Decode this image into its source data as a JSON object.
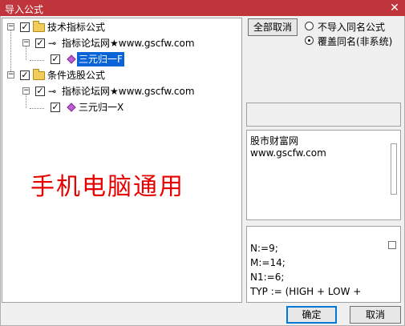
{
  "window": {
    "title": "导入公式",
    "close_glyph": "✕"
  },
  "tree": {
    "nodes": [
      {
        "label": "技术指标公式",
        "expander": "−",
        "checked": "✓"
      },
      {
        "label": "指标论坛网★www.gscfw.com",
        "expander": "−",
        "checked": "✓"
      },
      {
        "label": "三元归一F",
        "checked": "✓",
        "selected": true
      },
      {
        "label": "条件选股公式",
        "expander": "−",
        "checked": "✓"
      },
      {
        "label": "指标论坛网★www.gscfw.com",
        "expander": "−",
        "checked": "✓"
      },
      {
        "label": "三元归一X",
        "checked": "✓"
      }
    ]
  },
  "watermark": "手机电脑通用",
  "options": {
    "cancel_all_label": "全部取消",
    "radio_no_import": "不导入同名公式",
    "radio_overwrite": "覆盖同名(非系统)",
    "selected_radio": "overwrite"
  },
  "description": {
    "lines": [
      "股市财富网",
      "www.gscfw.com"
    ]
  },
  "code": {
    "lines": [
      "N:=9;",
      "M:=14;",
      "N1:=6;",
      "TYP := (HIGH + LOW +"
    ]
  },
  "footer": {
    "ok_label": "确定",
    "cancel_label": "取消"
  },
  "colors": {
    "titlebar": "#c0343b",
    "selection": "#0a64d8",
    "watermark": "#e60000"
  }
}
